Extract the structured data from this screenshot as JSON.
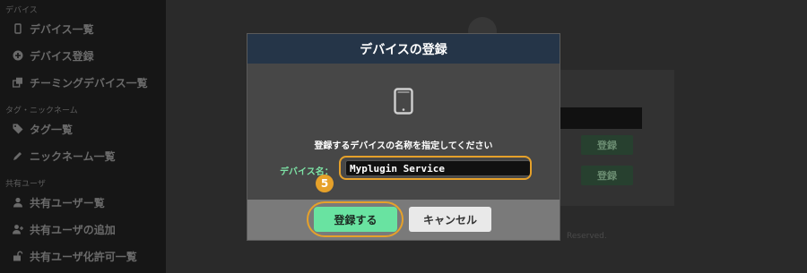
{
  "sidebar": {
    "section_devices": "デバイス",
    "items_devices": [
      {
        "label": "デバイス一覧",
        "icon": "device-icon"
      },
      {
        "label": "デバイス登録",
        "icon": "plus-circle-icon"
      },
      {
        "label": "チーミングデバイス一覧",
        "icon": "clone-icon"
      }
    ],
    "section_tags": "タグ・ニックネーム",
    "items_tags": [
      {
        "label": "タグ一覧",
        "icon": "tags-icon"
      },
      {
        "label": "ニックネーム一覧",
        "icon": "pencil-icon"
      }
    ],
    "section_shared": "共有ユーザ",
    "items_shared": [
      {
        "label": "共有ユーザー覧",
        "icon": "user-icon"
      },
      {
        "label": "共有ユーザの追加",
        "icon": "user-plus-icon"
      },
      {
        "label": "共有ユーザ化許可一覧",
        "icon": "unlock-icon"
      }
    ]
  },
  "background": {
    "register_btn_1": "登録",
    "register_btn_2": "登録",
    "footer_text": "Reserved."
  },
  "modal": {
    "title": "デバイスの登録",
    "icon": "tablet-icon",
    "prompt": "登録するデバイスの名称を指定してください",
    "field_label": "デバイス名：",
    "device_name_value": "Myplugin Service",
    "step_number": "5",
    "register_label": "登録する",
    "cancel_label": "キャンセル"
  },
  "colors": {
    "modal_header": "#253548",
    "accent_green": "#69e3a1",
    "highlight_orange": "#e6a12a"
  }
}
